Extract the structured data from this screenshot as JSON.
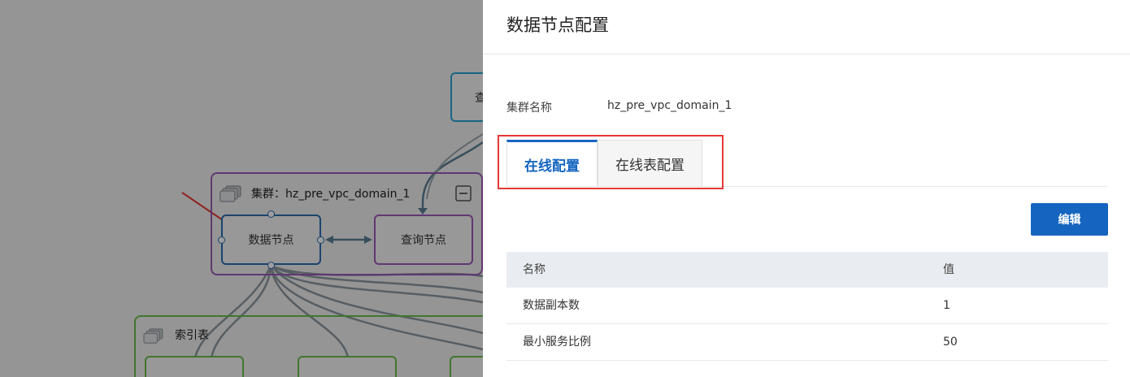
{
  "canvas": {
    "top_node_label_partial": "查",
    "cluster_group": {
      "title": "集群：hz_pre_vpc_domain_1",
      "collapse_icon": "minus-square-icon"
    },
    "data_node_label": "数据节点",
    "query_node_label": "查询节点",
    "index_group": {
      "title": "索引表"
    }
  },
  "drawer": {
    "title": "数据节点配置",
    "cluster_name_label": "集群名称",
    "cluster_name_value": "hz_pre_vpc_domain_1",
    "tabs": [
      {
        "label": "在线配置",
        "active": true
      },
      {
        "label": "在线表配置",
        "active": false
      }
    ],
    "edit_label": "编辑",
    "table": {
      "headers": [
        "名称",
        "值"
      ],
      "rows": [
        [
          "数据副本数",
          "1"
        ],
        [
          "最小服务比例",
          "50"
        ]
      ]
    }
  },
  "colors": {
    "accent": "#1565c0",
    "highlight": "#e53935",
    "cluster_border": "#9b59b6",
    "index_border": "#6abf4b",
    "top_node_border": "#29a3d6"
  }
}
